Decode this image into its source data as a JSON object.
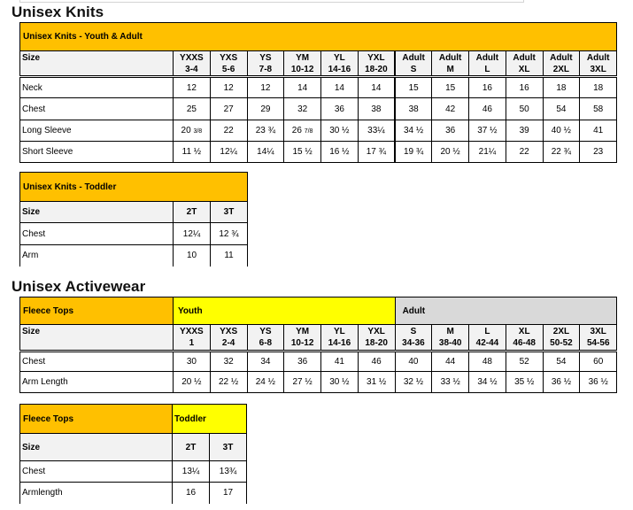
{
  "sections": {
    "knits_title": "Unisex Knits",
    "activewear_title": "Unisex Activewear"
  },
  "knits_youth_adult": {
    "band_label": "Unisex Knits - Youth & Adult",
    "size_label": "Size",
    "columns": [
      {
        "line1": "YXXS",
        "line2": "3-4"
      },
      {
        "line1": "YXS",
        "line2": "5-6"
      },
      {
        "line1": "YS",
        "line2": "7-8"
      },
      {
        "line1": "YM",
        "line2": "10-12"
      },
      {
        "line1": "YL",
        "line2": "14-16"
      },
      {
        "line1": "YXL",
        "line2": "18-20"
      },
      {
        "line1": "Adult",
        "line2": "S"
      },
      {
        "line1": "Adult",
        "line2": "M"
      },
      {
        "line1": "Adult",
        "line2": "L"
      },
      {
        "line1": "Adult",
        "line2": "XL"
      },
      {
        "line1": "Adult",
        "line2": "2XL"
      },
      {
        "line1": "Adult",
        "line2": "3XL"
      }
    ],
    "rows": [
      {
        "label": "Neck",
        "values": [
          "12",
          "12",
          "12",
          "14",
          "14",
          "14",
          "15",
          "15",
          "16",
          "16",
          "18",
          "18"
        ]
      },
      {
        "label": "Chest",
        "values": [
          "25",
          "27",
          "29",
          "32",
          "36",
          "38",
          "38",
          "42",
          "46",
          "50",
          "54",
          "58"
        ]
      },
      {
        "label": "Long Sleeve",
        "values": [
          "20 3/8",
          "22",
          "23 ¾",
          "26 7/8",
          "30 ½",
          "33¼",
          "34 ½",
          "36",
          "37 ½",
          "39",
          "40 ½",
          "41"
        ]
      },
      {
        "label": "Short Sleeve",
        "values": [
          "11 ½",
          "12¼",
          "14¼",
          "15 ½",
          "16 ½",
          "17 ¾",
          "19 ¾",
          "20 ½",
          "21¼",
          "22",
          "22 ¾",
          "23"
        ]
      }
    ]
  },
  "knits_toddler": {
    "band_label": "Unisex Knits - Toddler",
    "size_label": "Size",
    "columns": [
      "2T",
      "3T"
    ],
    "rows": [
      {
        "label": "Chest",
        "values": [
          "12¼",
          "12 ¾"
        ]
      },
      {
        "label": "Arm",
        "values": [
          "10",
          "11"
        ]
      }
    ]
  },
  "fleece_youth_adult": {
    "band_label": "Fleece Tops",
    "youth_label": "Youth",
    "adult_label": "Adult",
    "size_label": "Size",
    "columns": [
      {
        "line1": "YXXS",
        "line2": "1"
      },
      {
        "line1": "YXS",
        "line2": "2-4"
      },
      {
        "line1": "YS",
        "line2": "6-8"
      },
      {
        "line1": "YM",
        "line2": "10-12"
      },
      {
        "line1": "YL",
        "line2": "14-16"
      },
      {
        "line1": "YXL",
        "line2": "18-20"
      },
      {
        "line1": "S",
        "line2": "34-36"
      },
      {
        "line1": "M",
        "line2": "38-40"
      },
      {
        "line1": "L",
        "line2": "42-44"
      },
      {
        "line1": "XL",
        "line2": "46-48"
      },
      {
        "line1": "2XL",
        "line2": "50-52"
      },
      {
        "line1": "3XL",
        "line2": "54-56"
      }
    ],
    "rows": [
      {
        "label": "Chest",
        "values": [
          "30",
          "32",
          "34",
          "36",
          "41",
          "46",
          "40",
          "44",
          "48",
          "52",
          "54",
          "60"
        ]
      },
      {
        "label": "Arm Length",
        "values": [
          "20 ½",
          "22 ½",
          "24 ½",
          "27 ½",
          "30 ½",
          "31 ½",
          "32 ½",
          "33 ½",
          "34 ½",
          "35 ½",
          "36 ½",
          "36 ½"
        ]
      }
    ]
  },
  "fleece_toddler": {
    "band_label": "Fleece Tops",
    "toddler_label": "Toddler",
    "size_label": "Size",
    "columns": [
      "2T",
      "3T"
    ],
    "rows": [
      {
        "label": "Chest",
        "values": [
          "13¼",
          "13¾"
        ]
      },
      {
        "label": "Armlength",
        "values": [
          "16",
          "17"
        ]
      }
    ]
  },
  "colors": {
    "band_orange": "#ffc000",
    "band_yellow": "#ffff00",
    "band_gray": "#d9d9d9",
    "header_gray": "#f2f2f2"
  }
}
